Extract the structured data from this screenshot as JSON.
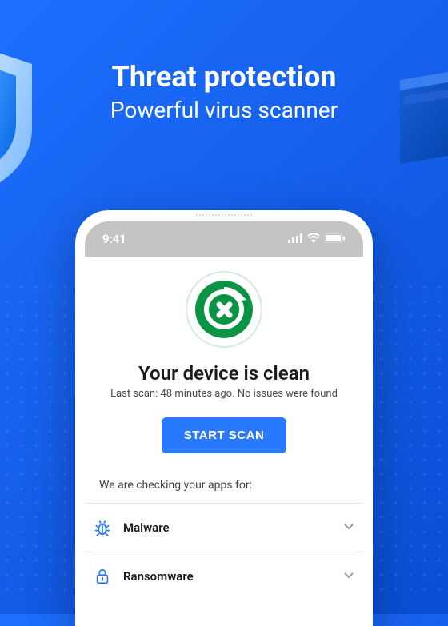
{
  "header": {
    "title": "Threat protection",
    "subtitle": "Powerful virus scanner"
  },
  "statusBar": {
    "time": "9:41"
  },
  "scanner": {
    "title": "Your device is clean",
    "subtitle": "Last scan: 48 minutes ago. No issues were found",
    "buttonLabel": "START SCAN",
    "checkingText": "We are checking your apps for:"
  },
  "scanItems": [
    {
      "label": "Malware"
    },
    {
      "label": "Ransomware"
    }
  ],
  "colors": {
    "primary": "#2979FF",
    "logoGreen": "#0b9444"
  }
}
